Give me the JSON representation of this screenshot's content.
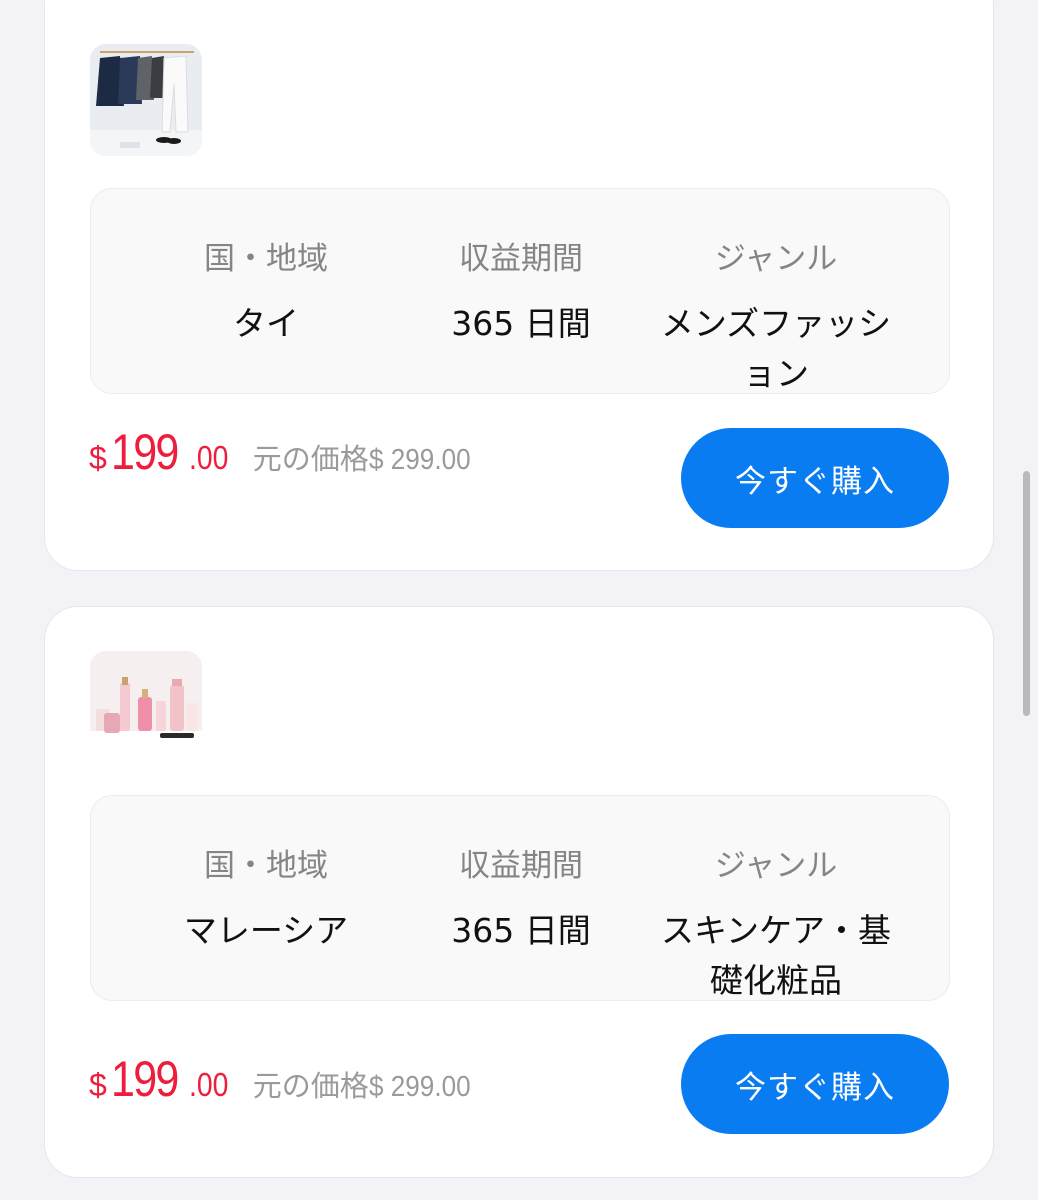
{
  "colors": {
    "accent": "#0a7cf2",
    "price": "#ee1d3e",
    "muted": "#9a9a9a",
    "background": "#f2f2f7"
  },
  "labels": {
    "region": "国・地域",
    "period": "収益期間",
    "genre": "ジャンル",
    "original_price_prefix": "元の価格",
    "buy_button": "今すぐ購入"
  },
  "products": [
    {
      "thumbnail_icon": "mens-clothing-rack-image",
      "region": "タイ",
      "period": "365 日間",
      "genre": "メンズファッション",
      "currency": "$",
      "price_int": "199",
      "price_dec": ".00",
      "original_price": "$ 299.00"
    },
    {
      "thumbnail_icon": "skincare-bottles-image",
      "region": "マレーシア",
      "period": "365 日間",
      "genre": "スキンケア・基礎化粧品",
      "currency": "$",
      "price_int": "199",
      "price_dec": ".00",
      "original_price": "$ 299.00"
    }
  ]
}
